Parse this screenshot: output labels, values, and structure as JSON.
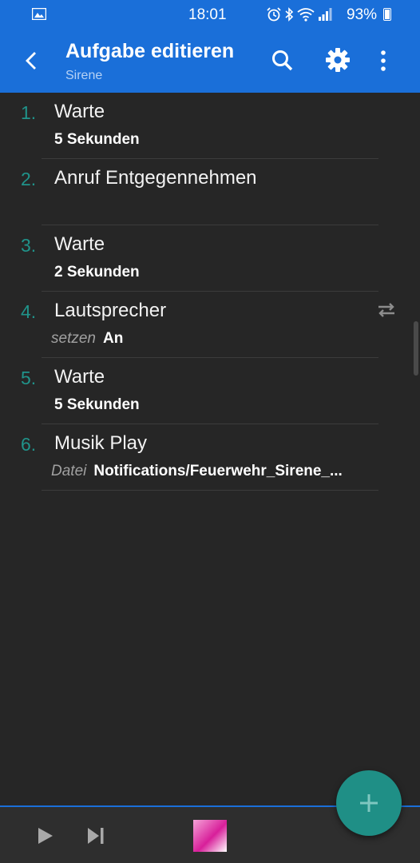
{
  "status_bar": {
    "time": "18:01",
    "battery": "93%",
    "icons": [
      "image-icon",
      "alarm-icon",
      "bluetooth-icon",
      "wifi-icon",
      "signal-icon",
      "battery-icon"
    ]
  },
  "app_bar": {
    "title": "Aufgabe editieren",
    "subtitle": "Sirene",
    "icons": [
      "back-arrow-icon",
      "search-icon",
      "gear-icon",
      "more-vert-icon"
    ],
    "color": "#1a6fd9"
  },
  "actions": [
    {
      "num": "1.",
      "name": "Warte",
      "label": "",
      "value": "5 Sekunden"
    },
    {
      "num": "2.",
      "name": "Anruf Entgegennehmen",
      "label": "",
      "value": ""
    },
    {
      "num": "3.",
      "name": "Warte",
      "label": "",
      "value": "2 Sekunden"
    },
    {
      "num": "4.",
      "name": "Lautsprecher",
      "label": "setzen",
      "value": "An"
    },
    {
      "num": "5.",
      "name": "Warte",
      "label": "",
      "value": "5 Sekunden"
    },
    {
      "num": "6.",
      "name": "Musik Play",
      "label": "Datei",
      "value": "Notifications/Feuerwehr_Sirene_..."
    }
  ],
  "bottom_bar": {
    "icons": [
      "play-icon",
      "skip-next-icon",
      "task-thumbnail"
    ]
  },
  "fab": {
    "icon": "plus-icon",
    "color": "#1f8f86"
  },
  "accent_number_color": "#20938a"
}
